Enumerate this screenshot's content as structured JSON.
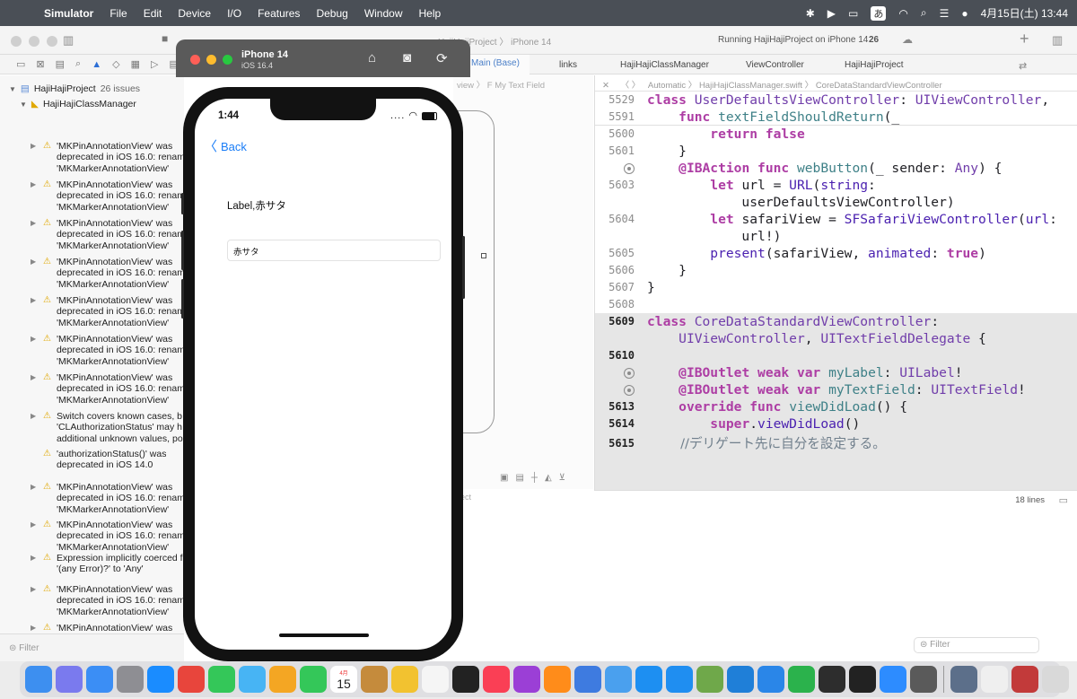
{
  "menubar": {
    "apple": "",
    "items": [
      "Simulator",
      "File",
      "Edit",
      "Device",
      "I/O",
      "Features",
      "Debug",
      "Window",
      "Help"
    ],
    "ime": "あ",
    "clock": "4月15日(土)  13:44"
  },
  "toolbar": {
    "project_title": "HajiHajiProject",
    "scheme": "HajiHajiProject 〉 iPhone 14",
    "status": "Running HajiHajiProject on iPhone 14",
    "issues_count": "26"
  },
  "navigator": {
    "project": "HajiHajiProject",
    "project_issues": "26 issues",
    "group": "HajiHajiClassManager",
    "issues": [
      {
        "text": "'MKPinAnnotationView' was\ndeprecated in iOS 16.0: renam\n'MKMarkerAnnotationView'"
      },
      {
        "text": "'MKPinAnnotationView' was\ndeprecated in iOS 16.0: renam\n'MKMarkerAnnotationView'"
      },
      {
        "text": "'MKPinAnnotationView' was\ndeprecated in iOS 16.0: renam\n'MKMarkerAnnotationView'"
      },
      {
        "text": "'MKPinAnnotationView' was\ndeprecated in iOS 16.0: renam\n'MKMarkerAnnotationView'"
      },
      {
        "text": "'MKPinAnnotationView' was\ndeprecated in iOS 16.0: renam\n'MKMarkerAnnotationView'"
      },
      {
        "text": "'MKPinAnnotationView' was\ndeprecated in iOS 16.0: renam\n'MKMarkerAnnotationView'"
      },
      {
        "text": "'MKPinAnnotationView' was\ndeprecated in iOS 16.0: renam\n'MKMarkerAnnotationView'"
      },
      {
        "text": "Switch covers known cases, b\n'CLAuthorizationStatus' may h\nadditional unknown values, po"
      },
      {
        "text": "'authorizationStatus()' was\ndeprecated in iOS 14.0"
      },
      {
        "text": "'MKPinAnnotationView' was\ndeprecated in iOS 16.0: renam\n'MKMarkerAnnotationView'"
      },
      {
        "text": "'MKPinAnnotationView' was\ndeprecated in iOS 16.0: renam\n'MKMarkerAnnotationView'"
      },
      {
        "text": "Expression implicitly coerced f\n'(any Error)?' to 'Any'"
      },
      {
        "text": "'MKPinAnnotationView' was\ndeprecated in iOS 16.0: renam\n'MKMarkerAnnotationView'"
      },
      {
        "text": "'MKPinAnnotationView' was\ndeprecated in iOS 16.0: renam\n'MKMarkerAnnotationView'"
      },
      {
        "text": "'MKPinAnnotationView' was"
      }
    ],
    "filter_placeholder": "Filter"
  },
  "canvas": {
    "tab": "Main (Base)",
    "breadcrumb": "view 〉 F  My Text Field",
    "status": "ect"
  },
  "editor_tabs": [
    "links",
    "HajiHajiClassManager",
    "ViewController",
    "HajiHajiProject"
  ],
  "jumpbar": "Automatic 〉  HajiHajiClassManager.swift 〉  CoreDataStandardViewController",
  "code": {
    "sticky": [
      {
        "num": "5529"
      },
      {
        "num": "5591"
      }
    ],
    "lines": [
      {
        "num": "5600",
        "bold": false
      },
      {
        "num": "5601",
        "bold": false
      },
      {
        "num": "",
        "bp": true
      },
      {
        "num": "5603",
        "bold": false
      },
      {
        "num": "",
        "bold": false
      },
      {
        "num": "5604",
        "bold": false
      },
      {
        "num": "",
        "bold": false
      },
      {
        "num": "5605",
        "bold": false
      },
      {
        "num": "5606",
        "bold": false
      },
      {
        "num": "5607",
        "bold": false
      },
      {
        "num": "5608",
        "bold": false
      },
      {
        "num": "5609",
        "bold": true
      },
      {
        "num": "",
        "bold": false
      },
      {
        "num": "5610",
        "bold": true
      },
      {
        "num": "",
        "bp": true
      },
      {
        "num": "",
        "bp": true
      },
      {
        "num": "5613",
        "bold": true
      },
      {
        "num": "5614",
        "bold": true
      },
      {
        "num": "5615",
        "bold": true
      }
    ],
    "lines_count": "18 lines"
  },
  "simulator": {
    "device": "iPhone 14",
    "os": "iOS 16.4",
    "time": "1:44",
    "signal": "....",
    "back": "Back",
    "label": "Label,赤サタ",
    "text_field_value": "赤サタ"
  },
  "right_filter_placeholder": "Filter",
  "dock": {
    "calendar_month": "4月",
    "calendar_day": "15",
    "apps": [
      "finder",
      "launchpad",
      "mail",
      "system-settings",
      "safari",
      "chrome",
      "messages",
      "maps",
      "photos",
      "facetime",
      "calendar",
      "notes-app",
      "notes",
      "reminders",
      "apple-tv",
      "music",
      "podcasts",
      "books",
      "xcode-tools",
      "simulator",
      "appstore-dev",
      "app-store",
      "sheets",
      "vscode",
      "keynote",
      "numbers",
      "github-desktop",
      "terminal",
      "zoom",
      "calculator",
      "preview",
      "textedit",
      "dictionary",
      "trash"
    ]
  },
  "colors": {
    "keyword": "#ad3da4",
    "type": "#703daa",
    "function": "#3e8087",
    "ios_blue": "#1a7df7",
    "warning": "#e0a800"
  }
}
